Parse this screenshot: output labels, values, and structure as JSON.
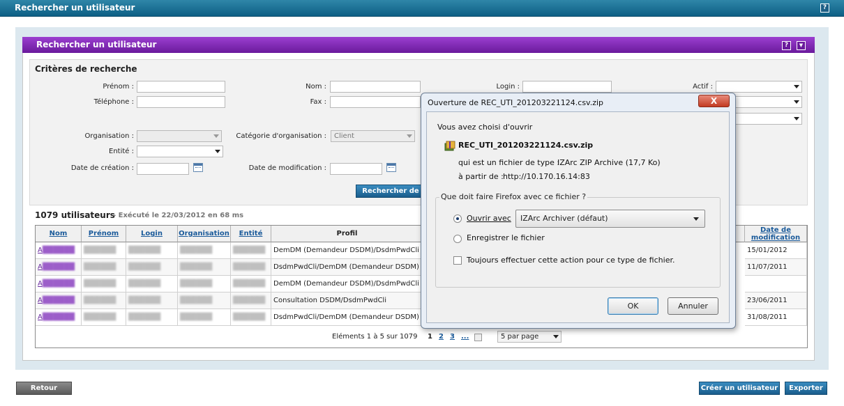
{
  "page": {
    "title": "Rechercher un utilisateur",
    "help": "?"
  },
  "panel": {
    "title": "Rechercher un utilisateur",
    "help": "?",
    "collapse": "▼"
  },
  "criteria": {
    "title": "Critères de recherche",
    "prenom_label": "Prénom :",
    "nom_label": "Nom :",
    "login_label": "Login :",
    "actif_label": "Actif :",
    "telephone_label": "Téléphone :",
    "fax_label": "Fax :",
    "organisation_label": "Organisation :",
    "organisation_value": "",
    "categorie_label": "Catégorie d'organisation :",
    "categorie_value": "Client",
    "entite_label": "Entité :",
    "date_creation_label": "Date de création :",
    "date_modification_label": "Date de modification :",
    "search_button": "Rechercher de"
  },
  "results": {
    "count": "1079 utilisateurs",
    "exec": "- Exécuté le 22/03/2012 en 68 ms",
    "columns": {
      "nom": "Nom",
      "prenom": "Prénom",
      "login": "Login",
      "organisation": "Organisation",
      "entite": "Entité",
      "profil": "Profil",
      "date_modif_1": "Date de",
      "date_modif_2": "modification"
    },
    "rows": [
      {
        "nom": "A",
        "prenom": "",
        "login": "",
        "organisation": "",
        "entite": "",
        "profil": "DemDM (Demandeur DSDM)/DsdmPwdCli",
        "date": "15/01/2012"
      },
      {
        "nom": "A",
        "prenom": "",
        "login": "",
        "organisation": "",
        "entite": "",
        "profil": "DsdmPwdCli/DemDM (Demandeur DSDM)",
        "date": "11/07/2011"
      },
      {
        "nom": "A",
        "prenom": "",
        "login": "",
        "organisation": "",
        "entite": "",
        "profil": "DemDM (Demandeur DSDM)/DsdmPwdCli",
        "date": ""
      },
      {
        "nom": "A",
        "prenom": "",
        "login": "",
        "organisation": "",
        "entite": "",
        "profil": "Consultation DSDM/DsdmPwdCli",
        "date": "23/06/2011"
      },
      {
        "nom": "A",
        "prenom": "",
        "login": "",
        "organisation": "",
        "entite": "",
        "profil": "DsdmPwdCli/DemDM (Demandeur DSDM)",
        "date": "31/08/2011"
      }
    ],
    "pager": {
      "summary": "Eléments 1 à 5 sur 1079",
      "p1": "1",
      "p2": "2",
      "p3": "3",
      "more": "...",
      "per_page": "5 par page"
    }
  },
  "footer": {
    "retour": "Retour",
    "creer": "Créer un utilisateur",
    "exporter": "Exporter"
  },
  "dialog": {
    "title": "Ouverture de REC_UTI_201203221124.csv.zip",
    "close": "X",
    "intro": "Vous avez choisi d'ouvrir",
    "filename": "REC_UTI_201203221124.csv.zip",
    "type_label": "qui est un fichier de type :",
    "type_value": "IZArc ZIP Archive (17,7 Ko)",
    "from_label": "à partir de :",
    "from_value": "http://10.170.16.14:83",
    "question": "Que doit faire Firefox avec ce fichier ?",
    "open_with": "Ouvrir avec",
    "open_with_app": "IZArc Archiver (défaut)",
    "save_file": "Enregistrer le fichier",
    "always": "Toujours effectuer cette action pour ce type de fichier.",
    "ok": "OK",
    "cancel": "Annuler"
  },
  "colors": {
    "header_blue": "#0d5f85",
    "panel_purple": "#6a1a9c",
    "button_blue": "#1a5d8c",
    "link_blue": "#1a5a9a"
  }
}
